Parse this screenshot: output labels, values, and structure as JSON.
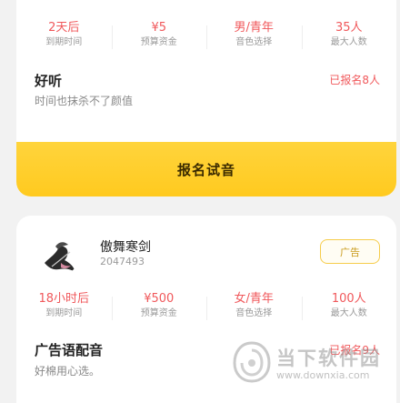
{
  "card1": {
    "stats": [
      {
        "value": "2天后",
        "label": "到期时间"
      },
      {
        "value": "¥5",
        "label": "预算资金"
      },
      {
        "value": "男/青年",
        "label": "音色选择"
      },
      {
        "value": "35人",
        "label": "最大人数"
      }
    ],
    "title": "好听",
    "signed": "已报名8人",
    "description": "时间也抹杀不了颜值",
    "button_label": "报名试音"
  },
  "card2": {
    "user": {
      "name": "傲舞寒剑",
      "id": "2047493"
    },
    "tag": "广告",
    "stats": [
      {
        "value": "18小时后",
        "label": "到期时间"
      },
      {
        "value": "¥500",
        "label": "预算资金"
      },
      {
        "value": "女/青年",
        "label": "音色选择"
      },
      {
        "value": "100人",
        "label": "最大人数"
      }
    ],
    "title": "广告语配音",
    "signed": "已报名9人",
    "description": "好棉用心选。"
  },
  "watermark": {
    "name": "当下软件园",
    "url": "www.downxia.com"
  }
}
